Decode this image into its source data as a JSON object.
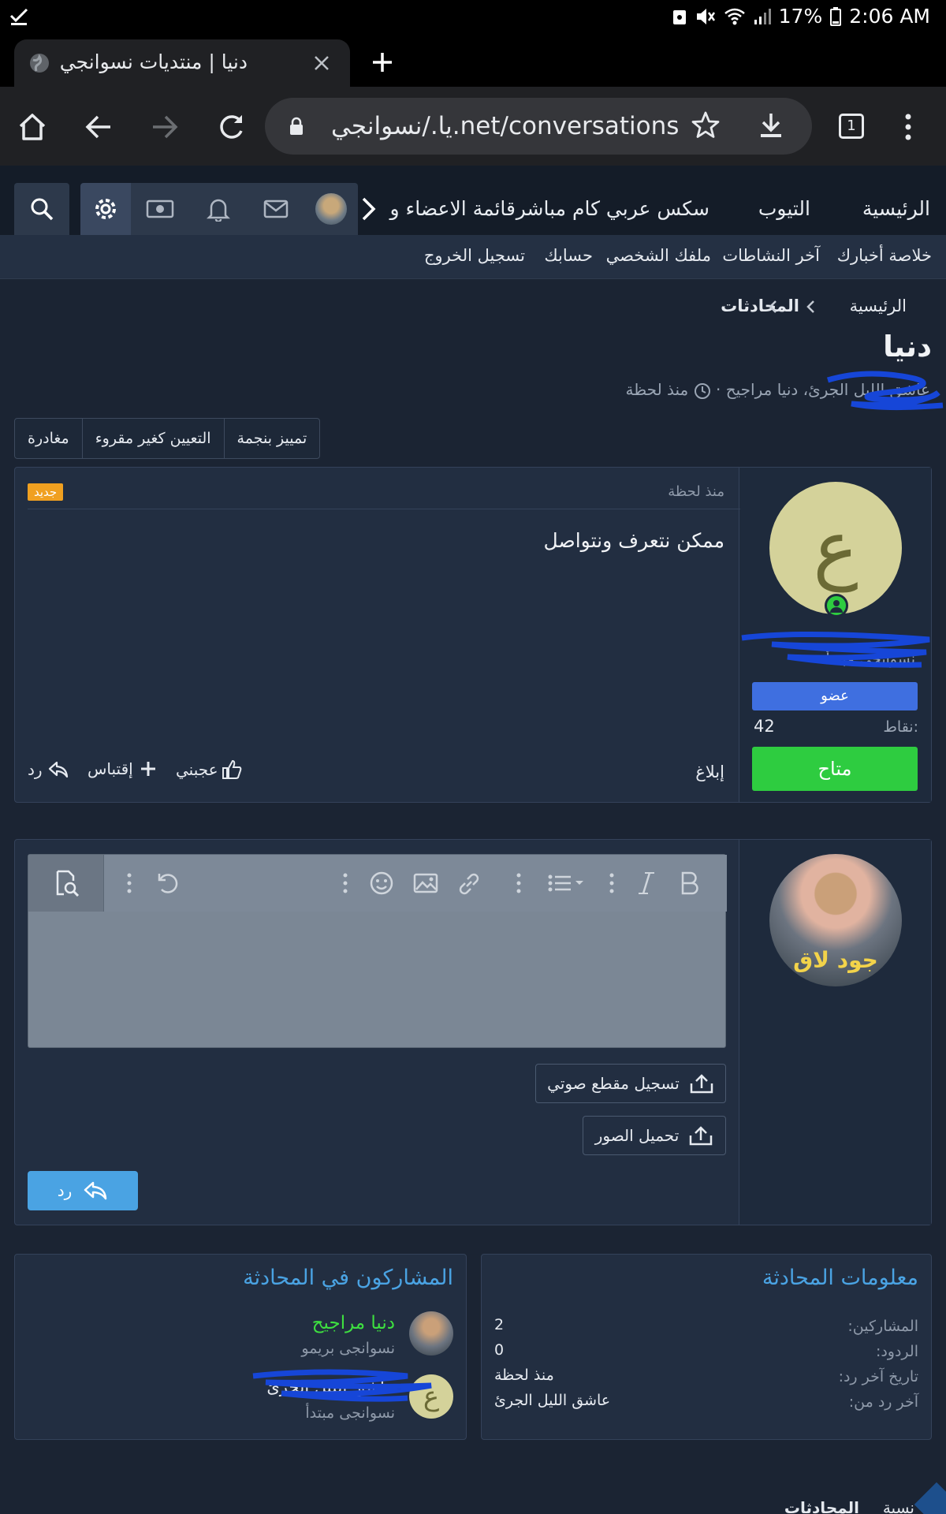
{
  "status_bar": {
    "battery": "17%",
    "time": "2:06 AM"
  },
  "browser": {
    "tab_title": "دنيا | منتديات نسوانجي",
    "url": "يا./نسوانجي.net/conversations",
    "tab_count": "1"
  },
  "site_nav": {
    "items": [
      "الرئيسية",
      "التيوب",
      "سكس عربي كام مباشر",
      "قائمة الاعضاء و"
    ]
  },
  "sub_nav": {
    "items": [
      "خلاصة أخبارك",
      "آخر النشاطات",
      "ملفك الشخصي",
      "حسابك",
      "تسجيل الخروج"
    ]
  },
  "breadcrumb": {
    "home": "الرئيسية",
    "section": "المحادثات"
  },
  "conversation": {
    "title": "دنيا",
    "participants": "عاشق الليل الجرئ، دنيا مراجيح",
    "time": "منذ لحظة"
  },
  "actions": {
    "star": "تمييز بنجمة",
    "mark_unread": "التعيين كغير مقروء",
    "leave": "مغادرة"
  },
  "message": {
    "time": "منذ لحظة",
    "badge": "جديد",
    "text": "ممكن نتعرف ونتواصل",
    "report": "إبلاغ",
    "like": "عجبني",
    "quote": "إقتباس",
    "reply": "رد"
  },
  "author": {
    "avatar_letter": "ع",
    "title": "نسوانجى مبتدأ",
    "role": "عضو",
    "points_label": "نقاط:",
    "points": "42",
    "status": "متاح"
  },
  "composer": {
    "record_audio": "تسجيل مقطع صوتي",
    "upload_images": "تحميل الصور",
    "reply_button": "رد",
    "avatar_caption": "جود لاق"
  },
  "info_panel": {
    "title": "معلومات المحادثة",
    "rows": [
      {
        "label": "المشاركين:",
        "value": "2"
      },
      {
        "label": "الردود:",
        "value": "0"
      },
      {
        "label": "تاريخ آخر رد:",
        "value": "منذ لحظة"
      },
      {
        "label": "آخر رد من:",
        "value": "عاشق الليل الجرئ"
      }
    ]
  },
  "participants_panel": {
    "title": "المشاركون في المحادثة",
    "people": [
      {
        "name": "دنيا مراجيح",
        "rank": "نسوانجى بريمو"
      },
      {
        "name": "عاشق الليل الجرئ",
        "rank": "نسوانجى مبتدأ"
      }
    ]
  },
  "footer_breadcrumb": {
    "home": "نسية",
    "section": "المحادثات"
  },
  "colors": {
    "accent": "#4aa3e3",
    "online": "#2ecc40",
    "new_badge": "#f0a020",
    "role": "#3f6fe0"
  }
}
